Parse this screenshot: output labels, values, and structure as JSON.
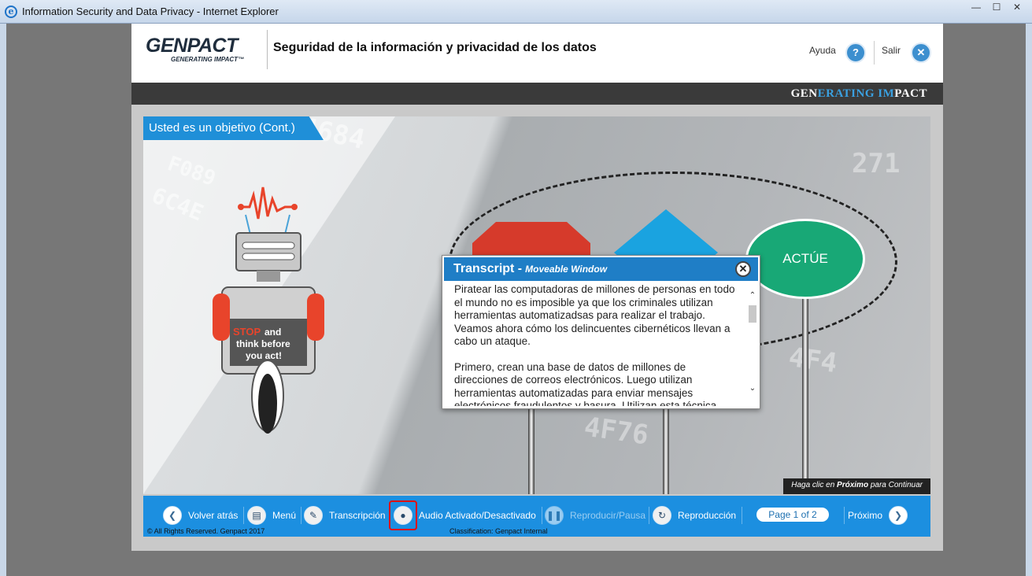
{
  "window": {
    "title": "Information Security and Data Privacy - Internet Explorer",
    "controls": [
      "—",
      "☐",
      "✕"
    ]
  },
  "header": {
    "brand": "GENPACT",
    "brand_tagline": "GENERATING IMPACT™",
    "course_title": "Seguridad de la información y privacidad de los datos",
    "help_label": "Ayuda",
    "help_icon": "?",
    "exit_label": "Salir",
    "exit_icon": "✕"
  },
  "brandbar": {
    "part1": "GEN",
    "part2": "ERATING ",
    "part3": "IM",
    "part4": "PACT"
  },
  "slide": {
    "title": "Usted es un objetivo (Cont.)",
    "sign_act": "ACTÚE",
    "robot_sign": {
      "line1_accent": "STOP",
      "line1_rest": " and",
      "line2": "think before",
      "line3": "you act!"
    },
    "next_hint_pre": "Haga clic en ",
    "next_hint_bold": "Próximo",
    "next_hint_post": " para Continuar"
  },
  "transcript": {
    "title": "Transcript -",
    "subtitle": "Moveable Window",
    "close_icon": "✕",
    "paragraph1": "Piratear las computadoras de millones de personas en todo el mundo no es imposible ya que los criminales utilizan herramientas automatizadsas para realizar el trabajo. Veamos ahora cómo los delincuentes cibernéticos llevan a cabo un ataque.",
    "paragraph2": "Primero, crean una base de datos de millones de direcciones de correos electrónicos. Luego utilizan herramientas automatizadas para enviar mensajes electrónicos fraudulentos y basura. Utilizan esta técnica"
  },
  "navbar": {
    "back_label": "Volver atrás",
    "menu_label": "Menú",
    "transcript_label": "Transcripción",
    "audio_label": "Audio Activado/Desactivado",
    "play_pause_label": "Reproducir/Pausa",
    "replay_label": "Reproducción",
    "page_indicator": "Page 1 of 2",
    "next_label": "Próximo",
    "copyright": "© All Rights Reserved. Genpact 2017",
    "classification": "Classification: Genpact Internal"
  },
  "colors": {
    "accent_blue": "#1c8fe0",
    "stop_red": "#d63a2b",
    "diamond_blue": "#1aa3e0",
    "act_green": "#18a876"
  }
}
